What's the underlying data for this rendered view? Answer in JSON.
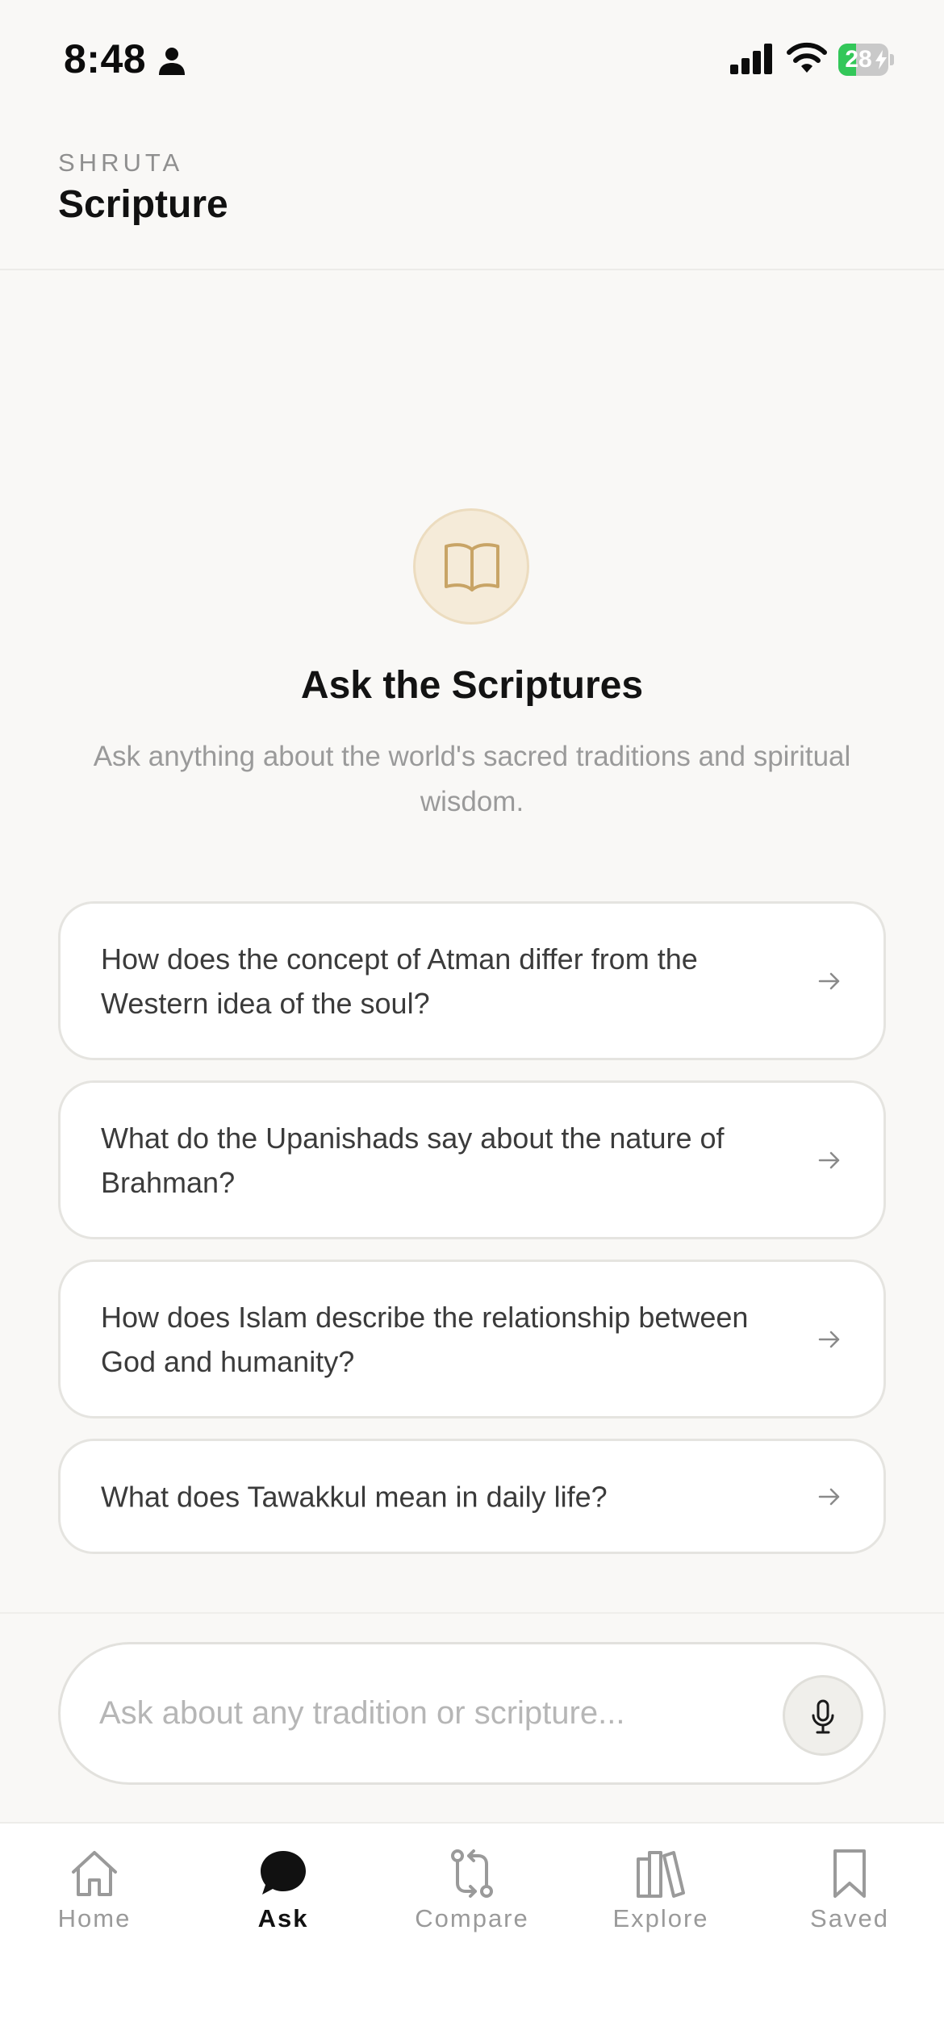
{
  "status_bar": {
    "time": "8:48",
    "battery_level": "28",
    "battery_fraction": 0.28,
    "battery_color": "#33c759",
    "icons": [
      "person-icon",
      "signal-icon",
      "wifi-icon",
      "battery-icon"
    ]
  },
  "header": {
    "brand": "SHRUTA",
    "title": "Scripture"
  },
  "hero": {
    "icon": "open-book-icon",
    "title": "Ask the Scriptures",
    "subtitle": "Ask anything about the world's sacred traditions and spiritual wisdom."
  },
  "suggestions": [
    {
      "text": "How does the concept of Atman differ from the Western idea of the soul?"
    },
    {
      "text": "What do the Upanishads say about the nature of Brahman?"
    },
    {
      "text": "How does Islam describe the relationship between God and humanity?"
    },
    {
      "text": "What does Tawakkul mean in daily life?"
    }
  ],
  "input": {
    "placeholder": "Ask about any tradition or scripture...",
    "value": ""
  },
  "tabs": [
    {
      "label": "Home",
      "icon": "home-icon",
      "active": false
    },
    {
      "label": "Ask",
      "icon": "chat-bubble-icon",
      "active": true
    },
    {
      "label": "Compare",
      "icon": "compare-icon",
      "active": false
    },
    {
      "label": "Explore",
      "icon": "books-icon",
      "active": false
    },
    {
      "label": "Saved",
      "icon": "bookmark-icon",
      "active": false
    }
  ],
  "colors": {
    "accent_gold": "#c8a466",
    "hero_icon_bg": "#f5ebd9",
    "background": "#f9f8f6",
    "active_tab": "#111111",
    "inactive_tab": "#9a9a9a"
  }
}
